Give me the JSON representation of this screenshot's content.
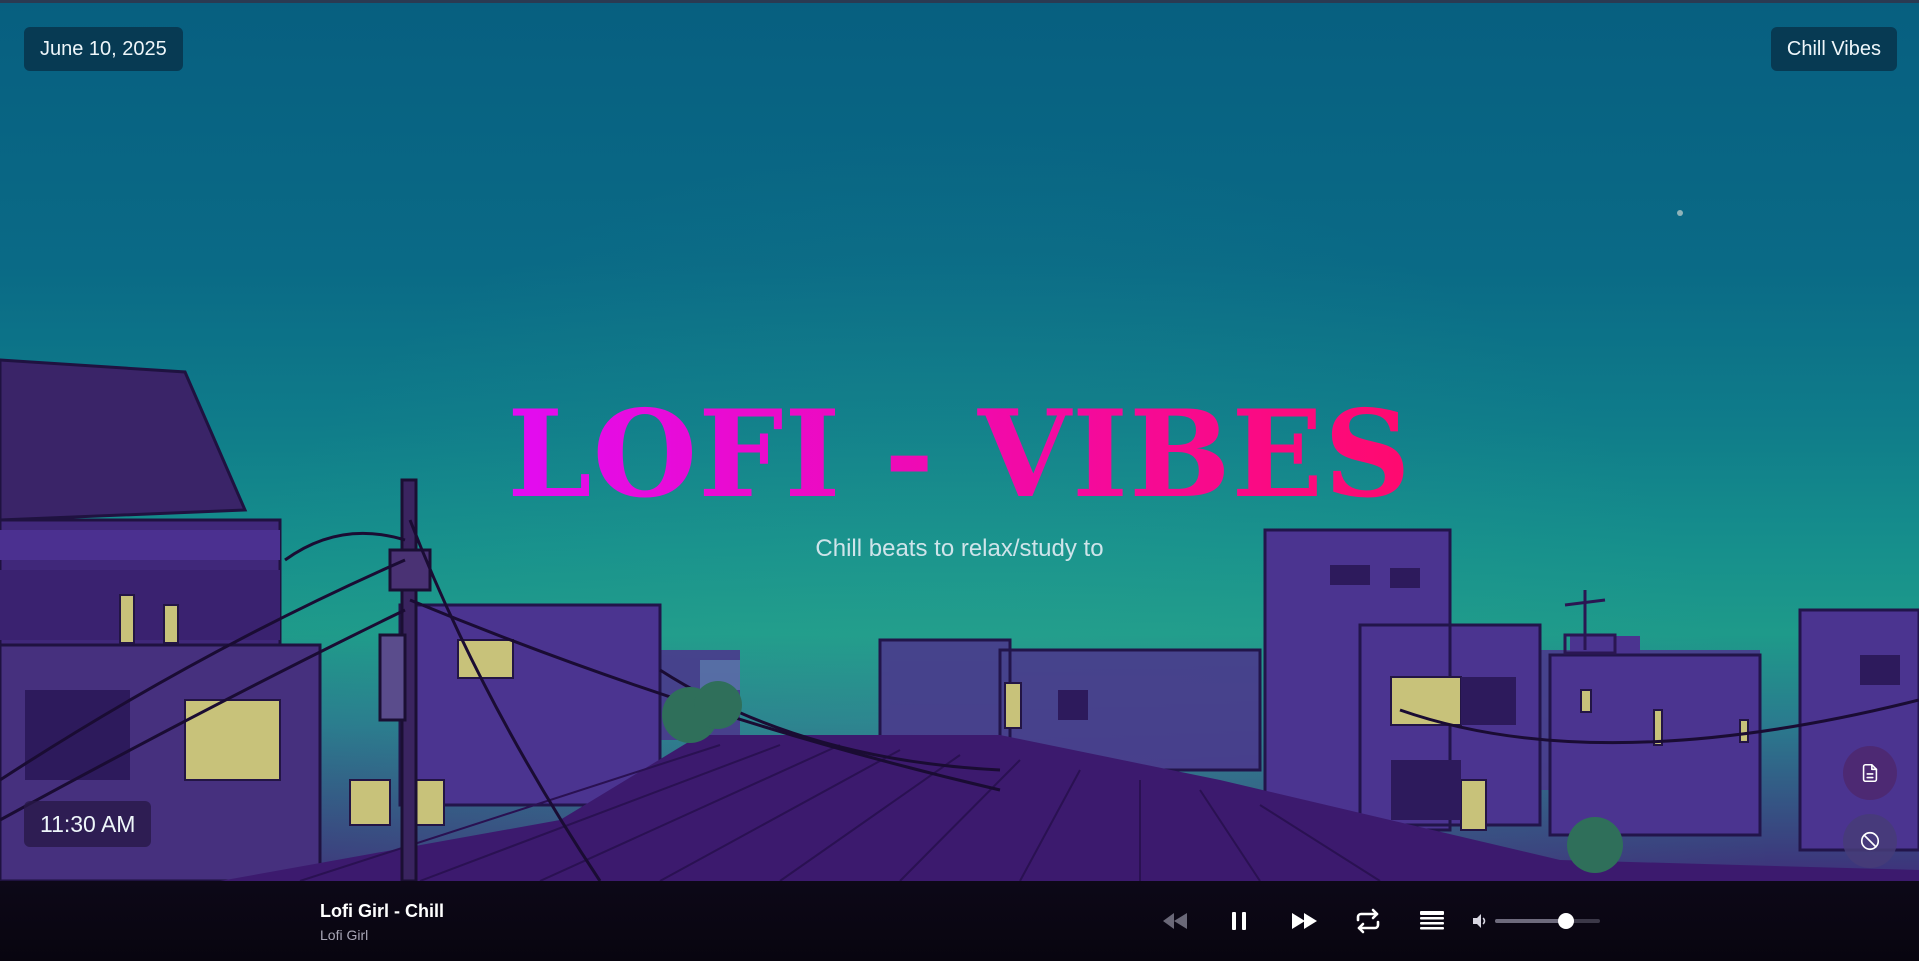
{
  "header": {
    "date": "June 10, 2025",
    "mood": "Chill Vibes"
  },
  "hero": {
    "title": "LOFI - VIBES",
    "subtitle": "Chill beats to relax/study to"
  },
  "clock": {
    "time": "11:30 AM"
  },
  "side_buttons": [
    {
      "icon": "notes-icon"
    },
    {
      "icon": "block-icon"
    }
  ],
  "player": {
    "track_title": "Lofi Girl - Chill",
    "track_artist": "Lofi Girl",
    "state": "playing",
    "controls": [
      "previous-icon",
      "pause-icon",
      "next-icon",
      "repeat-icon",
      "queue-icon"
    ],
    "volume_fraction": 0.68
  },
  "colors": {
    "title_gradient_start": "#e20cf2",
    "title_gradient_end": "#ff0a6e",
    "sky_top": "#075f80",
    "sky_horizon": "#1e9a8a",
    "buildings": "#3f2a7e",
    "player_bg": "#0b0614"
  }
}
